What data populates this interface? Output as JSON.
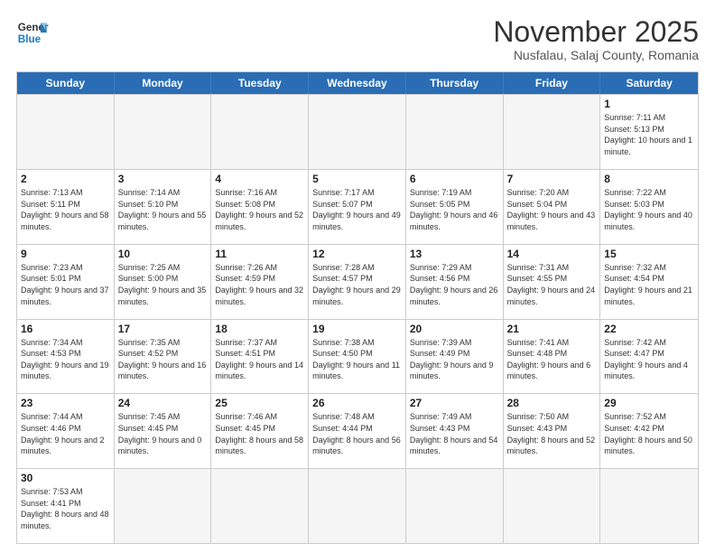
{
  "logo": {
    "text_general": "General",
    "text_blue": "Blue"
  },
  "title": "November 2025",
  "subtitle": "Nusfalau, Salaj County, Romania",
  "days_of_week": [
    "Sunday",
    "Monday",
    "Tuesday",
    "Wednesday",
    "Thursday",
    "Friday",
    "Saturday"
  ],
  "weeks": [
    [
      {
        "day": "",
        "empty": true
      },
      {
        "day": "",
        "empty": true
      },
      {
        "day": "",
        "empty": true
      },
      {
        "day": "",
        "empty": true
      },
      {
        "day": "",
        "empty": true
      },
      {
        "day": "",
        "empty": true
      },
      {
        "day": "1",
        "sunrise": "7:11 AM",
        "sunset": "5:13 PM",
        "daylight": "10 hours and 1 minute."
      }
    ],
    [
      {
        "day": "2",
        "sunrise": "7:13 AM",
        "sunset": "5:11 PM",
        "daylight": "9 hours and 58 minutes."
      },
      {
        "day": "3",
        "sunrise": "7:14 AM",
        "sunset": "5:10 PM",
        "daylight": "9 hours and 55 minutes."
      },
      {
        "day": "4",
        "sunrise": "7:16 AM",
        "sunset": "5:08 PM",
        "daylight": "9 hours and 52 minutes."
      },
      {
        "day": "5",
        "sunrise": "7:17 AM",
        "sunset": "5:07 PM",
        "daylight": "9 hours and 49 minutes."
      },
      {
        "day": "6",
        "sunrise": "7:19 AM",
        "sunset": "5:05 PM",
        "daylight": "9 hours and 46 minutes."
      },
      {
        "day": "7",
        "sunrise": "7:20 AM",
        "sunset": "5:04 PM",
        "daylight": "9 hours and 43 minutes."
      },
      {
        "day": "8",
        "sunrise": "7:22 AM",
        "sunset": "5:03 PM",
        "daylight": "9 hours and 40 minutes."
      }
    ],
    [
      {
        "day": "9",
        "sunrise": "7:23 AM",
        "sunset": "5:01 PM",
        "daylight": "9 hours and 37 minutes."
      },
      {
        "day": "10",
        "sunrise": "7:25 AM",
        "sunset": "5:00 PM",
        "daylight": "9 hours and 35 minutes."
      },
      {
        "day": "11",
        "sunrise": "7:26 AM",
        "sunset": "4:59 PM",
        "daylight": "9 hours and 32 minutes."
      },
      {
        "day": "12",
        "sunrise": "7:28 AM",
        "sunset": "4:57 PM",
        "daylight": "9 hours and 29 minutes."
      },
      {
        "day": "13",
        "sunrise": "7:29 AM",
        "sunset": "4:56 PM",
        "daylight": "9 hours and 26 minutes."
      },
      {
        "day": "14",
        "sunrise": "7:31 AM",
        "sunset": "4:55 PM",
        "daylight": "9 hours and 24 minutes."
      },
      {
        "day": "15",
        "sunrise": "7:32 AM",
        "sunset": "4:54 PM",
        "daylight": "9 hours and 21 minutes."
      }
    ],
    [
      {
        "day": "16",
        "sunrise": "7:34 AM",
        "sunset": "4:53 PM",
        "daylight": "9 hours and 19 minutes."
      },
      {
        "day": "17",
        "sunrise": "7:35 AM",
        "sunset": "4:52 PM",
        "daylight": "9 hours and 16 minutes."
      },
      {
        "day": "18",
        "sunrise": "7:37 AM",
        "sunset": "4:51 PM",
        "daylight": "9 hours and 14 minutes."
      },
      {
        "day": "19",
        "sunrise": "7:38 AM",
        "sunset": "4:50 PM",
        "daylight": "9 hours and 11 minutes."
      },
      {
        "day": "20",
        "sunrise": "7:39 AM",
        "sunset": "4:49 PM",
        "daylight": "9 hours and 9 minutes."
      },
      {
        "day": "21",
        "sunrise": "7:41 AM",
        "sunset": "4:48 PM",
        "daylight": "9 hours and 6 minutes."
      },
      {
        "day": "22",
        "sunrise": "7:42 AM",
        "sunset": "4:47 PM",
        "daylight": "9 hours and 4 minutes."
      }
    ],
    [
      {
        "day": "23",
        "sunrise": "7:44 AM",
        "sunset": "4:46 PM",
        "daylight": "9 hours and 2 minutes."
      },
      {
        "day": "24",
        "sunrise": "7:45 AM",
        "sunset": "4:45 PM",
        "daylight": "9 hours and 0 minutes."
      },
      {
        "day": "25",
        "sunrise": "7:46 AM",
        "sunset": "4:45 PM",
        "daylight": "8 hours and 58 minutes."
      },
      {
        "day": "26",
        "sunrise": "7:48 AM",
        "sunset": "4:44 PM",
        "daylight": "8 hours and 56 minutes."
      },
      {
        "day": "27",
        "sunrise": "7:49 AM",
        "sunset": "4:43 PM",
        "daylight": "8 hours and 54 minutes."
      },
      {
        "day": "28",
        "sunrise": "7:50 AM",
        "sunset": "4:43 PM",
        "daylight": "8 hours and 52 minutes."
      },
      {
        "day": "29",
        "sunrise": "7:52 AM",
        "sunset": "4:42 PM",
        "daylight": "8 hours and 50 minutes."
      }
    ],
    [
      {
        "day": "30",
        "sunrise": "7:53 AM",
        "sunset": "4:41 PM",
        "daylight": "8 hours and 48 minutes."
      },
      {
        "day": "",
        "empty": true
      },
      {
        "day": "",
        "empty": true
      },
      {
        "day": "",
        "empty": true
      },
      {
        "day": "",
        "empty": true
      },
      {
        "day": "",
        "empty": true
      },
      {
        "day": "",
        "empty": true
      }
    ]
  ]
}
